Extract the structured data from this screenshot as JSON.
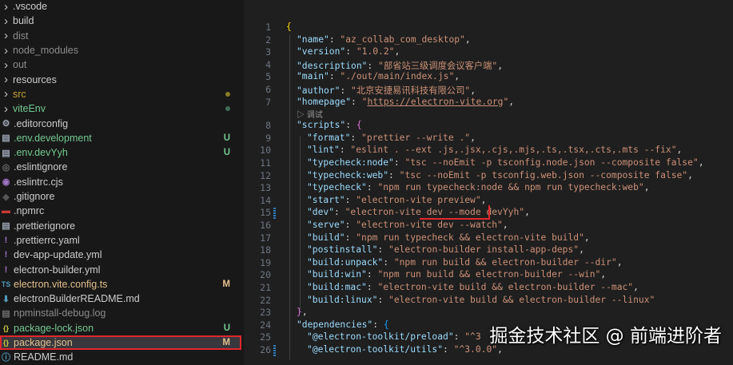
{
  "explorer": {
    "items": [
      {
        "label": ".vscode",
        "type": "folder",
        "color": "#cccccc"
      },
      {
        "label": "build",
        "type": "folder",
        "color": "#cccccc"
      },
      {
        "label": "dist",
        "type": "folder",
        "color": "#8c8c8c"
      },
      {
        "label": "node_modules",
        "type": "folder",
        "color": "#8c8c8c"
      },
      {
        "label": "out",
        "type": "folder",
        "color": "#8c8c8c"
      },
      {
        "label": "resources",
        "type": "folder",
        "color": "#cccccc"
      },
      {
        "label": "src",
        "type": "folder",
        "color": "#c5a332",
        "dot": "#8a7a2a"
      },
      {
        "label": "viteEnv",
        "type": "folder",
        "color": "#73c991",
        "dot": "#3f6e57"
      },
      {
        "label": ".editorconfig",
        "icon": "⚙",
        "iconColor": "#9da5b4",
        "color": "#cccccc"
      },
      {
        "label": ".env.development",
        "icon": "▤",
        "iconColor": "#9da5b4",
        "color": "#73c991",
        "badge": "U"
      },
      {
        "label": ".env.devYyh",
        "icon": "▤",
        "iconColor": "#9da5b4",
        "color": "#73c991",
        "badge": "U"
      },
      {
        "label": ".eslintignore",
        "icon": "◎",
        "iconColor": "#6d6d6d",
        "color": "#cccccc"
      },
      {
        "label": ".eslintrc.cjs",
        "icon": "◉",
        "iconColor": "#a074c4",
        "color": "#cccccc"
      },
      {
        "label": ".gitignore",
        "icon": "◆",
        "iconColor": "#555",
        "color": "#cccccc"
      },
      {
        "label": ".npmrc",
        "icon": "▬",
        "iconColor": "#cb3837",
        "color": "#cccccc"
      },
      {
        "label": ".prettierignore",
        "icon": "▤",
        "iconColor": "#9da5b4",
        "color": "#cccccc"
      },
      {
        "label": ".prettierrc.yaml",
        "icon": "!",
        "iconColor": "#a074c4",
        "color": "#cccccc"
      },
      {
        "label": "dev-app-update.yml",
        "icon": "!",
        "iconColor": "#a074c4",
        "color": "#cccccc"
      },
      {
        "label": "electron-builder.yml",
        "icon": "!",
        "iconColor": "#a074c4",
        "color": "#cccccc"
      },
      {
        "label": "electron.vite.config.ts",
        "icon": "TS",
        "iconColor": "#519aba",
        "color": "#e2c08d",
        "badge": "M"
      },
      {
        "label": "electronBuilderREADME.md",
        "icon": "⬇",
        "iconColor": "#519aba",
        "color": "#cccccc"
      },
      {
        "label": "npminstall-debug.log",
        "icon": "▤",
        "iconColor": "#6d6d6d",
        "color": "#8c8c8c"
      },
      {
        "label": "package-lock.json",
        "icon": "{}",
        "iconColor": "#cbcb41",
        "color": "#73c991",
        "badge": "U"
      },
      {
        "label": "package.json",
        "icon": "{}",
        "iconColor": "#cbcb41",
        "color": "#e2c08d",
        "badge": "M",
        "selected": true
      },
      {
        "label": "README.md",
        "icon": "ⓘ",
        "iconColor": "#519aba",
        "color": "#cccccc"
      }
    ]
  },
  "editor": {
    "codelens": "▷ 调试",
    "lines": [
      {
        "n": "1",
        "i": 0,
        "t": [
          [
            "{",
            "b1"
          ]
        ]
      },
      {
        "n": "2",
        "i": 1,
        "t": [
          [
            "\"name\"",
            "k"
          ],
          [
            ": ",
            "p"
          ],
          [
            "\"az_collab_com_desktop\"",
            "s"
          ],
          [
            ",",
            "p"
          ]
        ]
      },
      {
        "n": "3",
        "i": 1,
        "t": [
          [
            "\"version\"",
            "k"
          ],
          [
            ": ",
            "p"
          ],
          [
            "\"1.0.2\"",
            "s"
          ],
          [
            ",",
            "p"
          ]
        ]
      },
      {
        "n": "4",
        "i": 1,
        "t": [
          [
            "\"description\"",
            "k"
          ],
          [
            ": ",
            "p"
          ],
          [
            "\"部省站三级调度会议客户端\"",
            "s"
          ],
          [
            ",",
            "p"
          ]
        ]
      },
      {
        "n": "5",
        "i": 1,
        "t": [
          [
            "\"main\"",
            "k"
          ],
          [
            ": ",
            "p"
          ],
          [
            "\"./out/main/index.js\"",
            "s"
          ],
          [
            ",",
            "p"
          ]
        ]
      },
      {
        "n": "6",
        "i": 1,
        "t": [
          [
            "\"author\"",
            "k"
          ],
          [
            ": ",
            "p"
          ],
          [
            "\"北京安捷易讯科技有限公司\"",
            "s"
          ],
          [
            ",",
            "p"
          ]
        ]
      },
      {
        "n": "7",
        "i": 1,
        "t": [
          [
            "\"homepage\"",
            "k"
          ],
          [
            ": ",
            "p"
          ],
          [
            "\"",
            "s"
          ],
          [
            "https://electron-vite.org",
            "s u"
          ],
          [
            "\"",
            "s"
          ],
          [
            ",",
            "p"
          ]
        ]
      },
      {
        "n": "8",
        "i": 1,
        "t": [
          [
            "\"scripts\"",
            "k"
          ],
          [
            ": ",
            "p"
          ],
          [
            "{",
            "b2"
          ]
        ]
      },
      {
        "n": "9",
        "i": 2,
        "t": [
          [
            "\"format\"",
            "k"
          ],
          [
            ": ",
            "p"
          ],
          [
            "\"prettier --write .\"",
            "s"
          ],
          [
            ",",
            "p"
          ]
        ]
      },
      {
        "n": "10",
        "i": 2,
        "t": [
          [
            "\"lint\"",
            "k"
          ],
          [
            ": ",
            "p"
          ],
          [
            "\"eslint . --ext .js,.jsx,.cjs,.mjs,.ts,.tsx,.cts,.mts --fix\"",
            "s"
          ],
          [
            ",",
            "p"
          ]
        ]
      },
      {
        "n": "11",
        "i": 2,
        "t": [
          [
            "\"typecheck:node\"",
            "k"
          ],
          [
            ": ",
            "p"
          ],
          [
            "\"tsc --noEmit -p tsconfig.node.json --composite false\"",
            "s"
          ],
          [
            ",",
            "p"
          ]
        ]
      },
      {
        "n": "12",
        "i": 2,
        "t": [
          [
            "\"typecheck:web\"",
            "k"
          ],
          [
            ": ",
            "p"
          ],
          [
            "\"tsc --noEmit -p tsconfig.web.json --composite false\"",
            "s"
          ],
          [
            ",",
            "p"
          ]
        ]
      },
      {
        "n": "13",
        "i": 2,
        "t": [
          [
            "\"typecheck\"",
            "k"
          ],
          [
            ": ",
            "p"
          ],
          [
            "\"npm run typecheck:node && npm run typecheck:web\"",
            "s"
          ],
          [
            ",",
            "p"
          ]
        ]
      },
      {
        "n": "14",
        "i": 2,
        "t": [
          [
            "\"start\"",
            "k"
          ],
          [
            ": ",
            "p"
          ],
          [
            "\"electron-vite preview\"",
            "s"
          ],
          [
            ",",
            "p"
          ]
        ]
      },
      {
        "n": "15",
        "i": 2,
        "mod": true,
        "t": [
          [
            "\"dev\"",
            "k"
          ],
          [
            ": ",
            "p"
          ],
          [
            "\"electron-vite dev --mode devYyh\"",
            "s"
          ],
          [
            ",",
            "p"
          ]
        ]
      },
      {
        "n": "16",
        "i": 2,
        "t": [
          [
            "\"serve\"",
            "k"
          ],
          [
            ": ",
            "p"
          ],
          [
            "\"electron-vite dev --watch\"",
            "s"
          ],
          [
            ",",
            "p"
          ]
        ]
      },
      {
        "n": "17",
        "i": 2,
        "t": [
          [
            "\"build\"",
            "k"
          ],
          [
            ": ",
            "p"
          ],
          [
            "\"npm run typecheck && electron-vite build\"",
            "s"
          ],
          [
            ",",
            "p"
          ]
        ]
      },
      {
        "n": "18",
        "i": 2,
        "t": [
          [
            "\"postinstall\"",
            "k"
          ],
          [
            ": ",
            "p"
          ],
          [
            "\"electron-builder install-app-deps\"",
            "s"
          ],
          [
            ",",
            "p"
          ]
        ]
      },
      {
        "n": "19",
        "i": 2,
        "t": [
          [
            "\"build:unpack\"",
            "k"
          ],
          [
            ": ",
            "p"
          ],
          [
            "\"npm run build && electron-builder --dir\"",
            "s"
          ],
          [
            ",",
            "p"
          ]
        ]
      },
      {
        "n": "20",
        "i": 2,
        "t": [
          [
            "\"build:win\"",
            "k"
          ],
          [
            ": ",
            "p"
          ],
          [
            "\"npm run build && electron-builder --win\"",
            "s"
          ],
          [
            ",",
            "p"
          ]
        ]
      },
      {
        "n": "21",
        "i": 2,
        "t": [
          [
            "\"build:mac\"",
            "k"
          ],
          [
            ": ",
            "p"
          ],
          [
            "\"electron-vite build && electron-builder --mac\"",
            "s"
          ],
          [
            ",",
            "p"
          ]
        ]
      },
      {
        "n": "22",
        "i": 2,
        "t": [
          [
            "\"build:linux\"",
            "k"
          ],
          [
            ": ",
            "p"
          ],
          [
            "\"electron-vite build && electron-builder --linux\"",
            "s"
          ]
        ]
      },
      {
        "n": "23",
        "i": 1,
        "t": [
          [
            "}",
            "b2"
          ],
          [
            ",",
            "p"
          ]
        ]
      },
      {
        "n": "24",
        "i": 1,
        "t": [
          [
            "\"dependencies\"",
            "k"
          ],
          [
            ": ",
            "p"
          ],
          [
            "{",
            "b3"
          ]
        ]
      },
      {
        "n": "25",
        "i": 2,
        "t": [
          [
            "\"@electron-toolkit/preload\"",
            "k"
          ],
          [
            ": ",
            "p"
          ],
          [
            "\"^3",
            "s"
          ]
        ]
      },
      {
        "n": "26",
        "i": 2,
        "mod": true,
        "t": [
          [
            "\"@electron-toolkit/utils\"",
            "k"
          ],
          [
            ": ",
            "p"
          ],
          [
            "\"^3.0.0\"",
            "s"
          ],
          [
            ",",
            "p"
          ]
        ]
      }
    ]
  },
  "watermark": "掘金技术社区 @ 前端进阶者"
}
